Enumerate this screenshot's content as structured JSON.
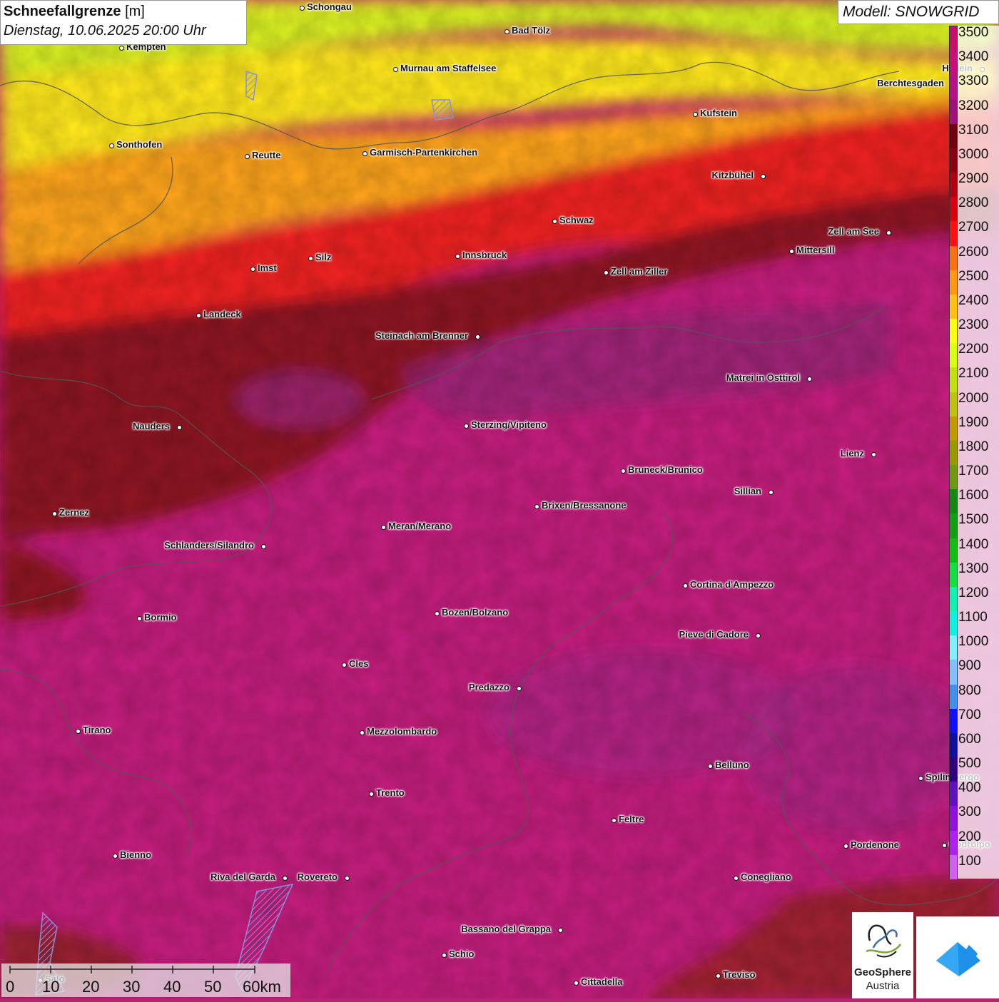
{
  "title": {
    "main": "Schneefallgrenze",
    "unit": "[m]",
    "date": "Dienstag, 10.06.2025 20:00 Uhr"
  },
  "model": "Modell: SNOWGRID",
  "legend": {
    "labels": [
      "3500",
      "3400",
      "3300",
      "3200",
      "3100",
      "3000",
      "2900",
      "2800",
      "2700",
      "2600",
      "2500",
      "2400",
      "2300",
      "2200",
      "2100",
      "2000",
      "1900",
      "1800",
      "1700",
      "1600",
      "1500",
      "1400",
      "1300",
      "1200",
      "1100",
      "1000",
      "900",
      "800",
      "700",
      "600",
      "500",
      "400",
      "300",
      "200",
      "100"
    ],
    "colors": [
      "#c8106a",
      "#c8107a",
      "#b81088",
      "#a0107a",
      "#6e0010",
      "#8a0010",
      "#b00010",
      "#d80010",
      "#ff1010",
      "#ff7010",
      "#ff9a10",
      "#ffc010",
      "#ffff10",
      "#d8ff10",
      "#c0e010",
      "#c0c010",
      "#c09a00",
      "#9a9a00",
      "#6e9a10",
      "#108a10",
      "#10a010",
      "#10c010",
      "#10e040",
      "#10f0b0",
      "#10f0e0",
      "#80f0ff",
      "#80c0ff",
      "#4090f0",
      "#1010ff",
      "#1010a0",
      "#300080",
      "#6010c0",
      "#9010e0",
      "#b020f0",
      "#d060f0"
    ]
  },
  "cities": [
    {
      "name": "Schongau",
      "side": "r"
    },
    {
      "name": "Bad Tölz",
      "side": "r"
    },
    {
      "name": "Kempten",
      "side": "r"
    },
    {
      "name": "Murnau am Staffelsee",
      "side": "r"
    },
    {
      "name": "Hallein",
      "side": "l"
    },
    {
      "name": "Berchtesgaden",
      "side": "l"
    },
    {
      "name": "Kufstein",
      "side": "r"
    },
    {
      "name": "Sonthofen",
      "side": "r"
    },
    {
      "name": "Reutte",
      "side": "r"
    },
    {
      "name": "Garmisch-Partenkirchen",
      "side": "r"
    },
    {
      "name": "Kitzbühel",
      "side": "l"
    },
    {
      "name": "Schwaz",
      "side": "r"
    },
    {
      "name": "Zell am See",
      "side": "l"
    },
    {
      "name": "Mittersill",
      "side": "r"
    },
    {
      "name": "Innsbruck",
      "side": "r"
    },
    {
      "name": "Silz",
      "side": "r"
    },
    {
      "name": "Imst",
      "side": "r"
    },
    {
      "name": "Zell am Ziller",
      "side": "r"
    },
    {
      "name": "Landeck",
      "side": "r"
    },
    {
      "name": "Steinach am Brenner",
      "side": "l"
    },
    {
      "name": "Matrei in Osttirol",
      "side": "l"
    },
    {
      "name": "Nauders",
      "side": "l"
    },
    {
      "name": "Sterzing/Vipiteno",
      "side": "r"
    },
    {
      "name": "Lienz",
      "side": "l"
    },
    {
      "name": "Bruneck/Brunico",
      "side": "r"
    },
    {
      "name": "Sillian",
      "side": "l"
    },
    {
      "name": "Brixen/Bressanone",
      "side": "r"
    },
    {
      "name": "Zernez",
      "side": "r"
    },
    {
      "name": "Meran/Merano",
      "side": "r"
    },
    {
      "name": "Schlanders/Silandro",
      "side": "l"
    },
    {
      "name": "Cortina d'Ampezzo",
      "side": "r"
    },
    {
      "name": "Bozen/Bolzano",
      "side": "r"
    },
    {
      "name": "Bormio",
      "side": "r"
    },
    {
      "name": "Pieve di Cadore",
      "side": "l"
    },
    {
      "name": "Cles",
      "side": "r"
    },
    {
      "name": "Predazzo",
      "side": "l"
    },
    {
      "name": "Tirano",
      "side": "r"
    },
    {
      "name": "Mezzolombardo",
      "side": "r"
    },
    {
      "name": "Belluno",
      "side": "r"
    },
    {
      "name": "Spilimbergo",
      "side": "r"
    },
    {
      "name": "Trento",
      "side": "r"
    },
    {
      "name": "Feltre",
      "side": "r"
    },
    {
      "name": "Pordenone",
      "side": "r"
    },
    {
      "name": "Codroipo",
      "side": "r"
    },
    {
      "name": "Bienno",
      "side": "r"
    },
    {
      "name": "Riva del Garda",
      "side": "l"
    },
    {
      "name": "Rovereto",
      "side": "l"
    },
    {
      "name": "Conegliano",
      "side": "r"
    },
    {
      "name": "Bassano del Grappa",
      "side": "l"
    },
    {
      "name": "Schio",
      "side": "r"
    },
    {
      "name": "Salò",
      "side": "r"
    },
    {
      "name": "Cittadella",
      "side": "r"
    },
    {
      "name": "Treviso",
      "side": "r"
    }
  ],
  "scale": {
    "labels": [
      "0",
      "10",
      "20",
      "30",
      "40",
      "50",
      "60km"
    ]
  },
  "logo": {
    "line1": "GeoSphere",
    "line2": "Austria"
  }
}
